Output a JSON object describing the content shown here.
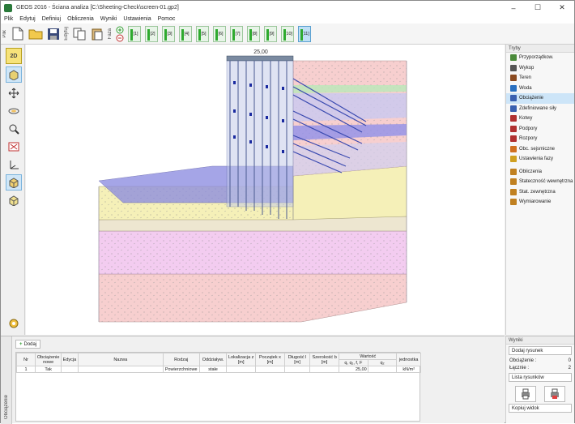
{
  "window": {
    "title": "GEOS 2016 - Ściana analiza [C:\\Sheeting-Check\\screen-01.gp2]",
    "controls": [
      "–",
      "☐",
      "✕"
    ]
  },
  "menu": [
    "Plik",
    "Edytuj",
    "Definiuj",
    "Obliczenia",
    "Wyniki",
    "Ustawienia",
    "Pomoc"
  ],
  "toolbar": {
    "file_label": "Plik",
    "edit_label": "Edytuj",
    "stage_label": "Faza",
    "stages": [
      "[1]",
      "[2]",
      "[3]",
      "[4]",
      "[5]",
      "[6]",
      "[7]",
      "[8]",
      "[9]",
      "[10]",
      "[11]"
    ],
    "active_stage_index": 10
  },
  "left_tools": [
    "2D",
    "3d-view-icon",
    "move-icon",
    "rotate-icon",
    "zoom-icon",
    "fit-icon",
    "axes-icon",
    "box-icon",
    "cube-icon",
    "settings-icon"
  ],
  "viewport": {
    "dimension_label": "25,00"
  },
  "right_panel": {
    "title": "Tryby",
    "items": [
      {
        "label": "Przyporządkow.",
        "color": "#4a8a3a"
      },
      {
        "label": "Wykop",
        "color": "#555555"
      },
      {
        "label": "Teren",
        "color": "#8a4a20"
      },
      {
        "label": "Woda",
        "color": "#2a70c0"
      },
      {
        "label": "Obciążenie",
        "color": "#3a60b0"
      },
      {
        "label": "Zdefiniowane siły",
        "color": "#3a60b0"
      },
      {
        "label": "Kotwy",
        "color": "#b03030"
      },
      {
        "label": "Podpory",
        "color": "#b03030"
      },
      {
        "label": "Rozpory",
        "color": "#b03030"
      },
      {
        "label": "Obc. sejsmiczne",
        "color": "#d07020"
      },
      {
        "label": "Ustawienia fazy",
        "color": "#d0a020"
      },
      {
        "label": "Obliczenia",
        "color": "#c08020"
      },
      {
        "label": "Stateczność wewnętrzna",
        "color": "#c08020"
      },
      {
        "label": "Stat. zewnętrzna",
        "color": "#c08020"
      },
      {
        "label": "Wymiarowanie",
        "color": "#c08020"
      }
    ],
    "selected_index": 4
  },
  "bottom": {
    "side_label": "Obciążenie",
    "add_label": "Dodaj",
    "headers": [
      "Nr",
      "Obciążenie nowe",
      "Edycja",
      "Nazwa",
      "Rodzaj",
      "Oddziaływ.",
      "Lokalizacja z [m]",
      "Początek x [m]",
      "Długość l [m]",
      "Szerokość b [m]",
      "Wartość",
      "jednostka"
    ],
    "value_subheaders": [
      "q, q₁, f, F",
      "q₂"
    ],
    "unit_value": "kN/m²",
    "row": {
      "nr": "1",
      "nowe": "Tak",
      "rodzaj": "Powierzchniowe",
      "oddzialyw": "stałe",
      "wartosc": "25,00"
    }
  },
  "results": {
    "title": "Wyniki",
    "add_figure": "Dodaj rysunek",
    "load_label": "Obciążenie :",
    "load_count": "0",
    "total_label": "Łącznie :",
    "total_count": "2",
    "list_label": "Lista rysunków",
    "copy_label": "Kopiuj widok"
  },
  "colors": {
    "soil_yellow": "#f5f0b8",
    "soil_pink": "#f6c6c6",
    "soil_magenta": "#f0c8f0",
    "blue_layer": "#8080e0",
    "wall": "#c0c8e8"
  }
}
